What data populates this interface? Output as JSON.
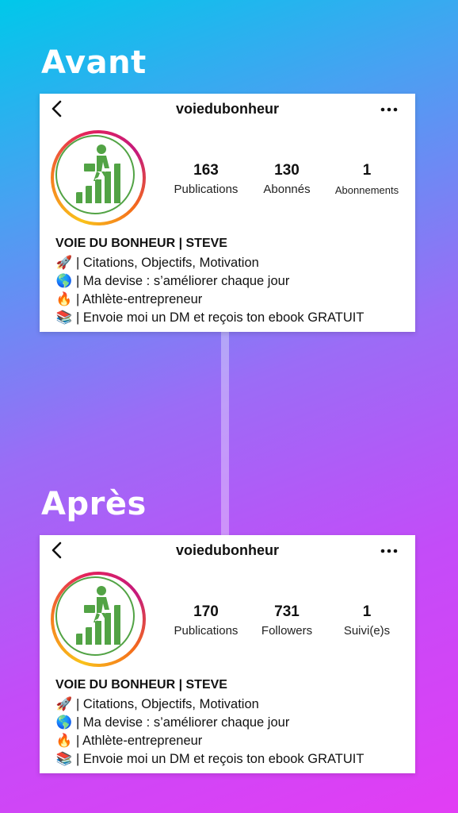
{
  "headings": {
    "before": "Avant",
    "after": "Après"
  },
  "before": {
    "username": "voiedubonheur",
    "stats": [
      {
        "value": "163",
        "label": "Publications"
      },
      {
        "value": "130",
        "label": "Abonnés"
      },
      {
        "value": "1",
        "label": "Abonnements"
      }
    ],
    "bio": {
      "name": "VOIE DU BONHEUR | STEVE",
      "lines": [
        {
          "emoji": "🚀",
          "text": "| Citations, Objectifs, Motivation"
        },
        {
          "emoji": "🌎",
          "text": "| Ma devise : s’améliorer chaque jour"
        },
        {
          "emoji": "🔥",
          "text": "| Athlète-entrepreneur"
        },
        {
          "emoji": "📚",
          "text": "| Envoie moi un DM et reçois ton ebook GRATUIT"
        }
      ]
    }
  },
  "after": {
    "username": "voiedubonheur",
    "stats": [
      {
        "value": "170",
        "label": "Publications"
      },
      {
        "value": "731",
        "label": "Followers"
      },
      {
        "value": "1",
        "label": "Suivi(e)s"
      }
    ],
    "bio": {
      "name": "VOIE DU BONHEUR | STEVE",
      "lines": [
        {
          "emoji": "🚀",
          "text": "| Citations, Objectifs, Motivation"
        },
        {
          "emoji": "🌎",
          "text": "| Ma devise : s’améliorer chaque jour"
        },
        {
          "emoji": "🔥",
          "text": "| Athlète-entrepreneur"
        },
        {
          "emoji": "📚",
          "text": "| Envoie moi un DM et reçois ton ebook GRATUIT"
        }
      ]
    }
  },
  "icons": {
    "back": "chevron-left-icon",
    "more": "more-horizontal-icon",
    "avatar": "businessman-climbing-stairs-logo"
  },
  "colors": {
    "logo_green": "#52a345",
    "ring_orange": "#f57e20",
    "ring_pink": "#e3225c"
  }
}
